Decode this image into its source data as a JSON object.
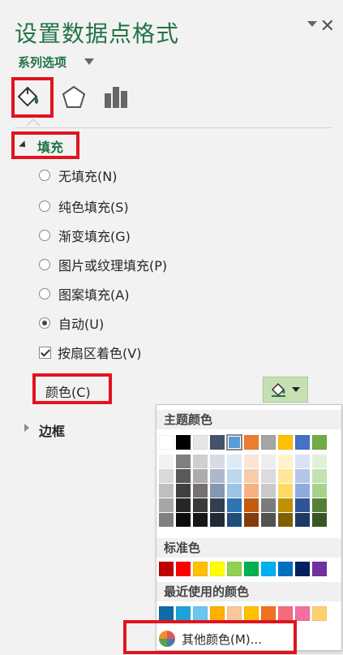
{
  "pane": {
    "title": "设置数据点格式",
    "series_options": "系列选项"
  },
  "tabs": [
    {
      "name": "fill-line",
      "icon": "paint-bucket-icon"
    },
    {
      "name": "effects",
      "icon": "pentagon-icon"
    },
    {
      "name": "series-options",
      "icon": "bar-chart-icon"
    }
  ],
  "fill": {
    "heading": "填充",
    "options": [
      {
        "label": "无填充(N)",
        "selected": false
      },
      {
        "label": "纯色填充(S)",
        "selected": false
      },
      {
        "label": "渐变填充(G)",
        "selected": false
      },
      {
        "label": "图片或纹理填充(P)",
        "selected": false
      },
      {
        "label": "图案填充(A)",
        "selected": false
      },
      {
        "label": "自动(U)",
        "selected": true
      }
    ],
    "vary_by_slice": {
      "label": "按扇区着色(V)",
      "checked": true
    },
    "color_label": "颜色(C)",
    "color_button_fill": "#c6e0b4"
  },
  "border": {
    "heading": "边框"
  },
  "palette": {
    "theme_heading": "主题颜色",
    "theme_base": [
      "#ffffff",
      "#000000",
      "#e7e6e6",
      "#44546a",
      "#5b9bd5",
      "#ed7d31",
      "#a5a5a5",
      "#ffc000",
      "#4472c4",
      "#70ad47"
    ],
    "theme_tints": [
      [
        "#f2f2f2",
        "#d9d9d9",
        "#bfbfbf",
        "#a6a6a6",
        "#808080"
      ],
      [
        "#7f7f7f",
        "#595959",
        "#404040",
        "#262626",
        "#0d0d0d"
      ],
      [
        "#d0cece",
        "#aeabab",
        "#757171",
        "#3a3838",
        "#171616"
      ],
      [
        "#d6dce4",
        "#adb9ca",
        "#8497b0",
        "#333f4f",
        "#222a35"
      ],
      [
        "#deebf7",
        "#bdd7ee",
        "#9dc3e6",
        "#2e75b6",
        "#1f4e79"
      ],
      [
        "#fbe5d6",
        "#f8cbad",
        "#f4b183",
        "#c55a11",
        "#843c0c"
      ],
      [
        "#ededed",
        "#dbdbdb",
        "#c9c9c9",
        "#7b7b7b",
        "#525252"
      ],
      [
        "#fff2cc",
        "#ffe699",
        "#ffd966",
        "#bf9000",
        "#7f6000"
      ],
      [
        "#dae3f3",
        "#b4c7e7",
        "#8faadc",
        "#2f5597",
        "#203864"
      ],
      [
        "#e2f0d9",
        "#c5e0b4",
        "#a9d18e",
        "#538135",
        "#375623"
      ]
    ],
    "standard_heading": "标准色",
    "standard": [
      "#c00000",
      "#ff0000",
      "#ffc000",
      "#ffff00",
      "#92d050",
      "#00b050",
      "#00b0f0",
      "#0070c0",
      "#002060",
      "#7030a0"
    ],
    "recent_heading": "最近使用的颜色",
    "recent": [
      "#0e6aa8",
      "#1fa2d8",
      "#69c7f0",
      "#ffb000",
      "#f8c89a",
      "#ffc000",
      "#f07024",
      "#f56b7a",
      "#f56fa0",
      "#ffd070"
    ],
    "more_colors": "其他颜色(M)..."
  }
}
